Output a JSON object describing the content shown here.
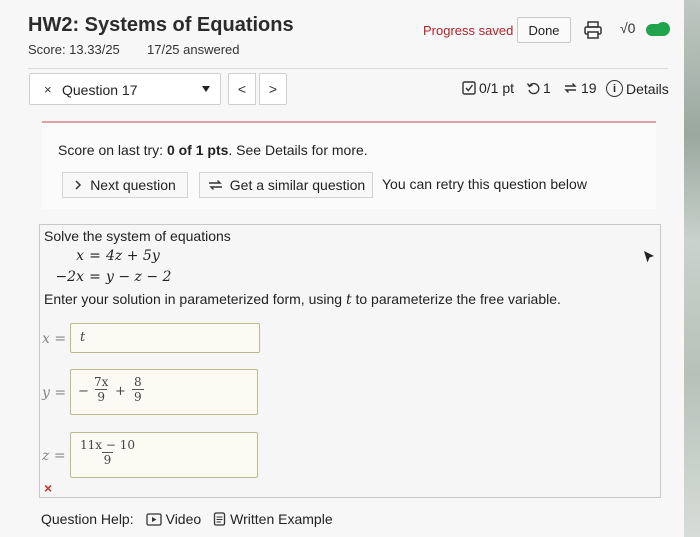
{
  "header": {
    "title": "HW2: Systems of Equations",
    "score": "Score: 13.33/25",
    "answered": "17/25 answered",
    "progress_saved": "Progress saved",
    "done_label": "Done",
    "print_icon": "print-icon",
    "math_icon": "√0",
    "toggle_on": true
  },
  "nav": {
    "question_label": "Question 17",
    "x_mark": "×",
    "prev_label": "<",
    "next_label": ">",
    "points": "0/1 pt",
    "retries": "1",
    "similar": "19",
    "details": "Details"
  },
  "feedback": {
    "score_prefix": "Score on last try: ",
    "score_value": "0 of 1 pts",
    "score_suffix": ". See Details for more.",
    "next_question": "Next question",
    "similar_question": "Get a similar question",
    "retry_note": "You can retry this question below"
  },
  "problem": {
    "intro": "Solve the system of equations",
    "eq1_lhs": "x",
    "eq1_op": "=",
    "eq1_rhs": "4z + 5y",
    "eq2_lhs": "−2x",
    "eq2_op": "=",
    "eq2_rhs": "y − z − 2",
    "instruction_a": "Enter your solution in parameterized form, using ",
    "instruction_var": "t",
    "instruction_b": " to parameterize the free variable.",
    "x_label": "x =",
    "x_answer": "t",
    "y_label": "y =",
    "y_minus": "−",
    "y_frac1_num": "7x",
    "y_frac1_den": "9",
    "y_plus": "+",
    "y_frac2_num": "8",
    "y_frac2_den": "9",
    "z_label": "z =",
    "z_frac_num": "11x − 10",
    "z_frac_den": "9",
    "result_mark": "×"
  },
  "help": {
    "label": "Question Help:",
    "video": "Video",
    "written": "Written Example"
  },
  "colors": {
    "progress_saved": "#b0232a",
    "toggle": "#20a34a",
    "feedback_rule": "#e3a0a4",
    "answer_border": "#bdb98e",
    "wrong": "#c0392b"
  }
}
